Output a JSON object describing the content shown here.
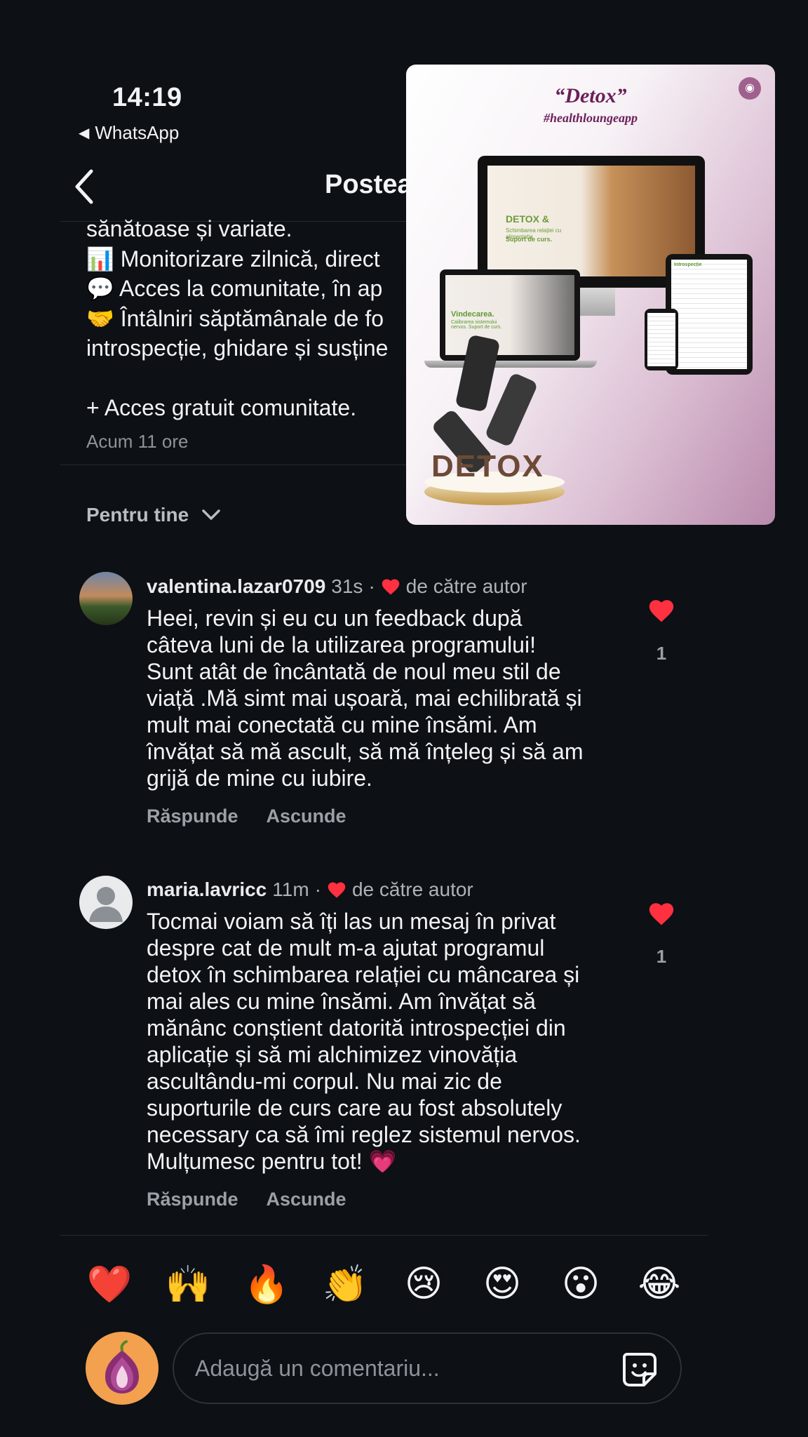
{
  "status": {
    "time": "14:19",
    "back_app": "WhatsApp"
  },
  "header": {
    "title": "Postea"
  },
  "post": {
    "lines": [
      "sănătoase și variate.",
      "📊 Monitorizare zilnică, direct",
      "💬 Acces la comunitate, în ap",
      "🤝 Întâlniri săptămânale de fo",
      "introspecție, ghidare și susține",
      "",
      "+ Acces gratuit comunitate."
    ],
    "time": "Acum 11 ore"
  },
  "sort": {
    "label": "Pentru tine"
  },
  "comments": [
    {
      "user": "valentina.lazar0709",
      "age": "31s",
      "sep": "·",
      "author_like": "de către autor",
      "lines": [
        "Heei, revin și eu cu un feedback după",
        "câteva luni de la utilizarea programului!",
        "Sunt atât de încântată de noul meu stil de",
        "viață .Mă simt mai ușoară, mai echilibrată și",
        "mult mai conectată cu mine însămi. Am",
        "învățat să mă ascult, să mă înțeleg și să am",
        "grijă de mine cu iubire."
      ],
      "reply": "Răspunde",
      "hide": "Ascunde",
      "likes": "1"
    },
    {
      "user": "maria.lavricc",
      "age": "11m",
      "sep": "·",
      "author_like": "de către autor",
      "lines": [
        "Tocmai voiam să îți las un mesaj în privat",
        "despre cat de mult m-a ajutat programul",
        "detox în schimbarea relației cu mâncarea și",
        "mai ales cu mine însămi. Am învățat să",
        "mănânc conștient datorită introspecției din",
        "aplicație și să mi alchimizez vinovăția",
        "ascultându-mi corpul. Nu mai zic de",
        "suporturile de curs care au fost absolutely",
        "necessary ca să îmi reglez sistemul nervos.",
        "Mulțumesc pentru tot! 💗"
      ],
      "reply": "Răspunde",
      "hide": "Ascunde",
      "likes": "1"
    }
  ],
  "emojis": [
    "❤️",
    "🙌",
    "🔥",
    "👏",
    "😢",
    "😍",
    "😮",
    "😂"
  ],
  "composer": {
    "placeholder": "Adaugă un comentariu..."
  },
  "overlay": {
    "title": "“Detox”",
    "tag": "#healthloungeapp",
    "monitor_title": "DETOX &",
    "monitor_sub": "Schimbarea relației cu alimentația",
    "monitor_sub2": "Suport de curs.",
    "laptop_title": "Vindecarea.",
    "laptop_sub": "Calibrarea sistemului nervos. Suport de curs.",
    "tablet_head": "Introspecție",
    "brand_word": "DETOX"
  },
  "colors": {
    "background": "#0d1014",
    "like_red": "#ff3040",
    "muted": "#8e939b"
  }
}
